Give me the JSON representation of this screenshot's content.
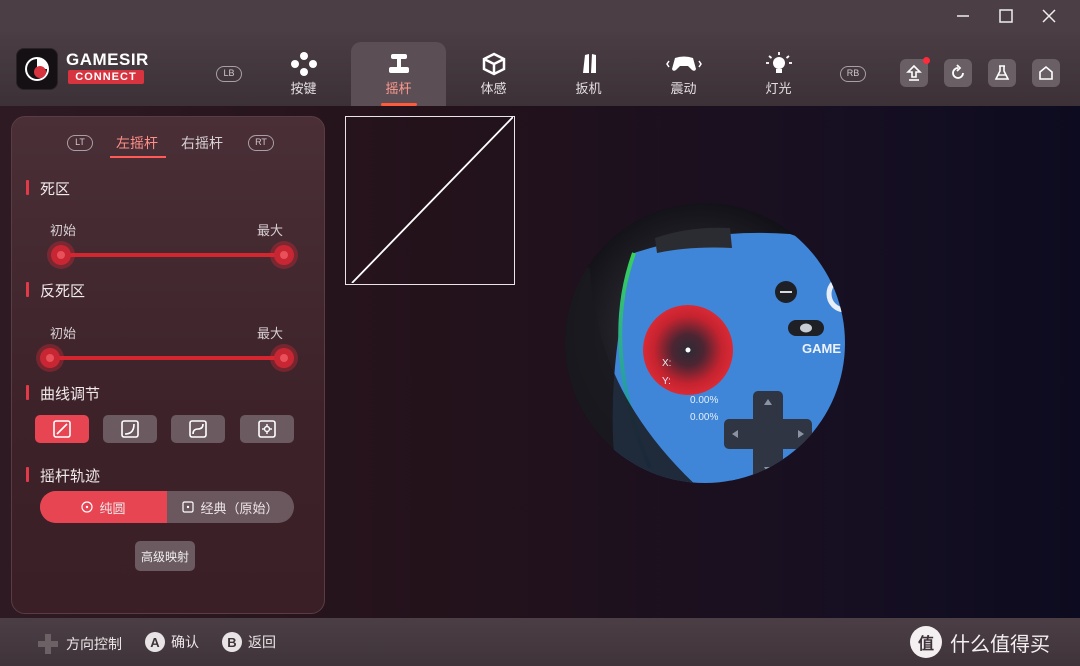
{
  "brand": {
    "name_line1": "GAMESIR",
    "name_line2": "CONNECT"
  },
  "window_controls": [
    "minimize",
    "maximize",
    "close"
  ],
  "shoulder_badges": {
    "left": "LB",
    "right": "RB"
  },
  "tabs": [
    {
      "label": "按键",
      "icon": "buttons-icon"
    },
    {
      "label": "摇杆",
      "icon": "joystick-icon",
      "active": true
    },
    {
      "label": "体感",
      "icon": "motion-cube-icon"
    },
    {
      "label": "扳机",
      "icon": "trigger-icon"
    },
    {
      "label": "震动",
      "icon": "vibration-gamepad-icon"
    },
    {
      "label": "灯光",
      "icon": "lightbulb-icon"
    }
  ],
  "toolbar": [
    "upload-icon",
    "reset-icon",
    "lab-flask-icon",
    "home-icon"
  ],
  "panel": {
    "trigger_left": "LT",
    "trigger_right": "RT",
    "stick_tabs": {
      "left": "左摇杆",
      "right": "右摇杆"
    },
    "deadzone": {
      "title": "死区",
      "min_label": "初始",
      "max_label": "最大"
    },
    "anti_deadzone": {
      "title": "反死区",
      "min_label": "初始",
      "max_label": "最大"
    },
    "curve": {
      "title": "曲线调节",
      "options": [
        "linear",
        "ease-in",
        "ease-out",
        "custom"
      ],
      "selected": 0
    },
    "trajectory": {
      "title": "摇杆轨迹",
      "options": [
        "纯圆",
        "经典（原始）"
      ],
      "selected": 0
    },
    "advanced_button": "高级映射"
  },
  "stick_readout": {
    "x_label": "X:",
    "x_value": "0.00%",
    "y_label": "Y:",
    "y_value": "0.00%"
  },
  "controller_brand_text": "GAME",
  "bottom_hints": [
    {
      "key": "dpad",
      "label": "方向控制"
    },
    {
      "key": "A",
      "label": "确认"
    },
    {
      "key": "B",
      "label": "返回"
    }
  ],
  "watermark": {
    "badge": "值",
    "text": "什么值得买"
  },
  "colors": {
    "accent": "#e84552",
    "active_tab_text": "#ff9a8f",
    "controller_blue": "#3f86d8"
  }
}
